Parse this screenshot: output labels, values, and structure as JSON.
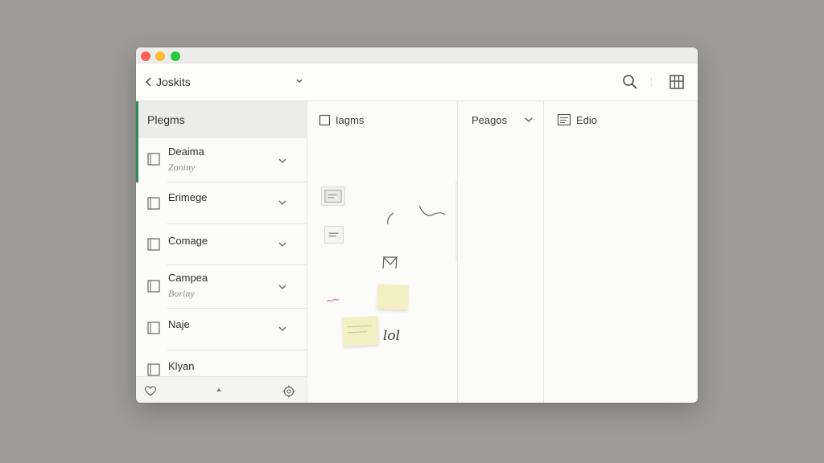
{
  "toolbar": {
    "back_label": "Joskits"
  },
  "sidebar": {
    "header": "Plegms",
    "items": [
      {
        "title": "Deaima",
        "subtitle": "Zoniny",
        "selected": true
      },
      {
        "title": "Erimege",
        "subtitle": ""
      },
      {
        "title": "Comage",
        "subtitle": ""
      },
      {
        "title": "Campea",
        "subtitle": "Boriny"
      },
      {
        "title": "Naje",
        "subtitle": ""
      },
      {
        "title": "Klyan",
        "subtitle": ""
      }
    ]
  },
  "columns": {
    "notes_header": "Iagms",
    "pages_header": "Peagos",
    "editor_header": "Edio"
  },
  "canvas": {
    "handwriting": "lol"
  },
  "colors": {
    "accent": "#2f8a5a",
    "sticky_note": "#f3efc4",
    "close": "#fe5f57",
    "minimize": "#febc2e",
    "zoom": "#28c840"
  },
  "icons": [
    "chevron-left-icon",
    "chevron-down-icon",
    "search-icon",
    "grid-icon",
    "notebook-icon",
    "heart-icon",
    "gear-icon",
    "checkbox-icon",
    "note-lines-icon"
  ]
}
